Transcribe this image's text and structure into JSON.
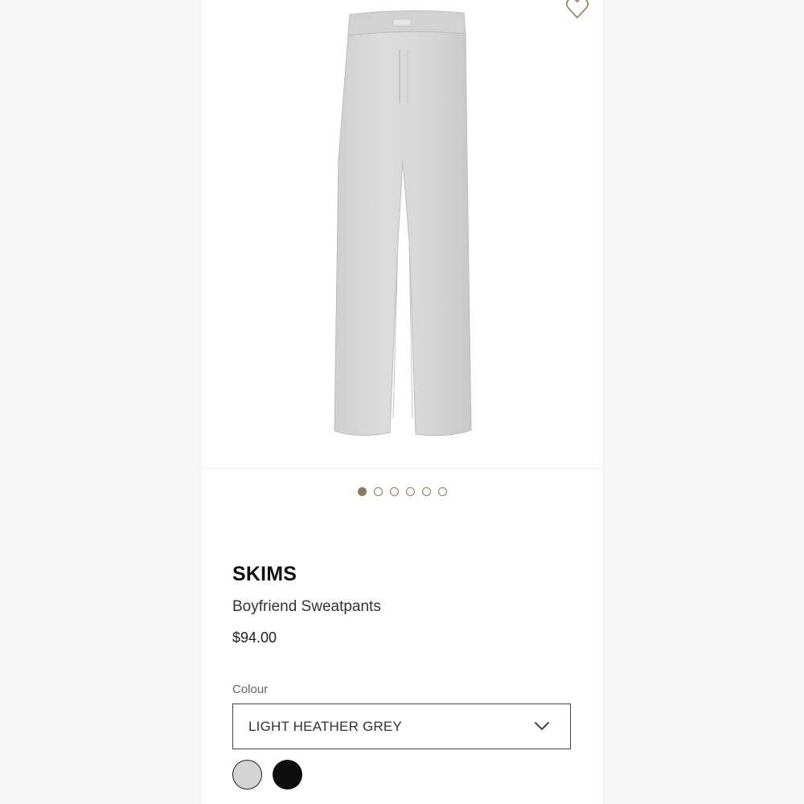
{
  "product": {
    "brand": "SKIMS",
    "name": "Boyfriend Sweatpants",
    "price": "$94.00"
  },
  "gallery": {
    "image_icon": "sweatpants-product-image",
    "total_images": 6,
    "active_index": 0,
    "dot_active_color": "#8b7a5a"
  },
  "wishlist": {
    "icon": "heart-icon"
  },
  "colour": {
    "label": "Colour",
    "selected": "LIGHT HEATHER GREY",
    "swatches": [
      {
        "name": "Light Heather Grey",
        "color": "#d4d4d4",
        "selected": true
      },
      {
        "name": "Black",
        "color": "#0d0d0d",
        "selected": false
      }
    ]
  }
}
